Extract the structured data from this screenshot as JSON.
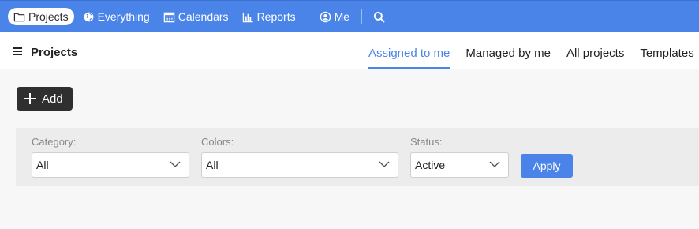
{
  "topnav": {
    "bg_color": "#4a84e8",
    "items": [
      {
        "label": "Projects",
        "icon": "folder-icon",
        "active": true
      },
      {
        "label": "Everything",
        "icon": "globe-icon"
      },
      {
        "label": "Calendars",
        "icon": "calendar-icon"
      },
      {
        "label": "Reports",
        "icon": "bar-chart-icon"
      },
      {
        "label": "Me",
        "icon": "user-circle-icon"
      }
    ],
    "search_icon": "search-icon"
  },
  "header": {
    "title": "Projects",
    "tabs": [
      {
        "label": "Assigned to me",
        "active": true
      },
      {
        "label": "Managed by me"
      },
      {
        "label": "All projects"
      },
      {
        "label": "Templates"
      }
    ]
  },
  "toolbar": {
    "add_label": "Add"
  },
  "filters": {
    "category": {
      "label": "Category:",
      "value": "All"
    },
    "colors": {
      "label": "Colors:",
      "value": "All"
    },
    "status": {
      "label": "Status:",
      "value": "Active"
    },
    "apply_label": "Apply"
  }
}
